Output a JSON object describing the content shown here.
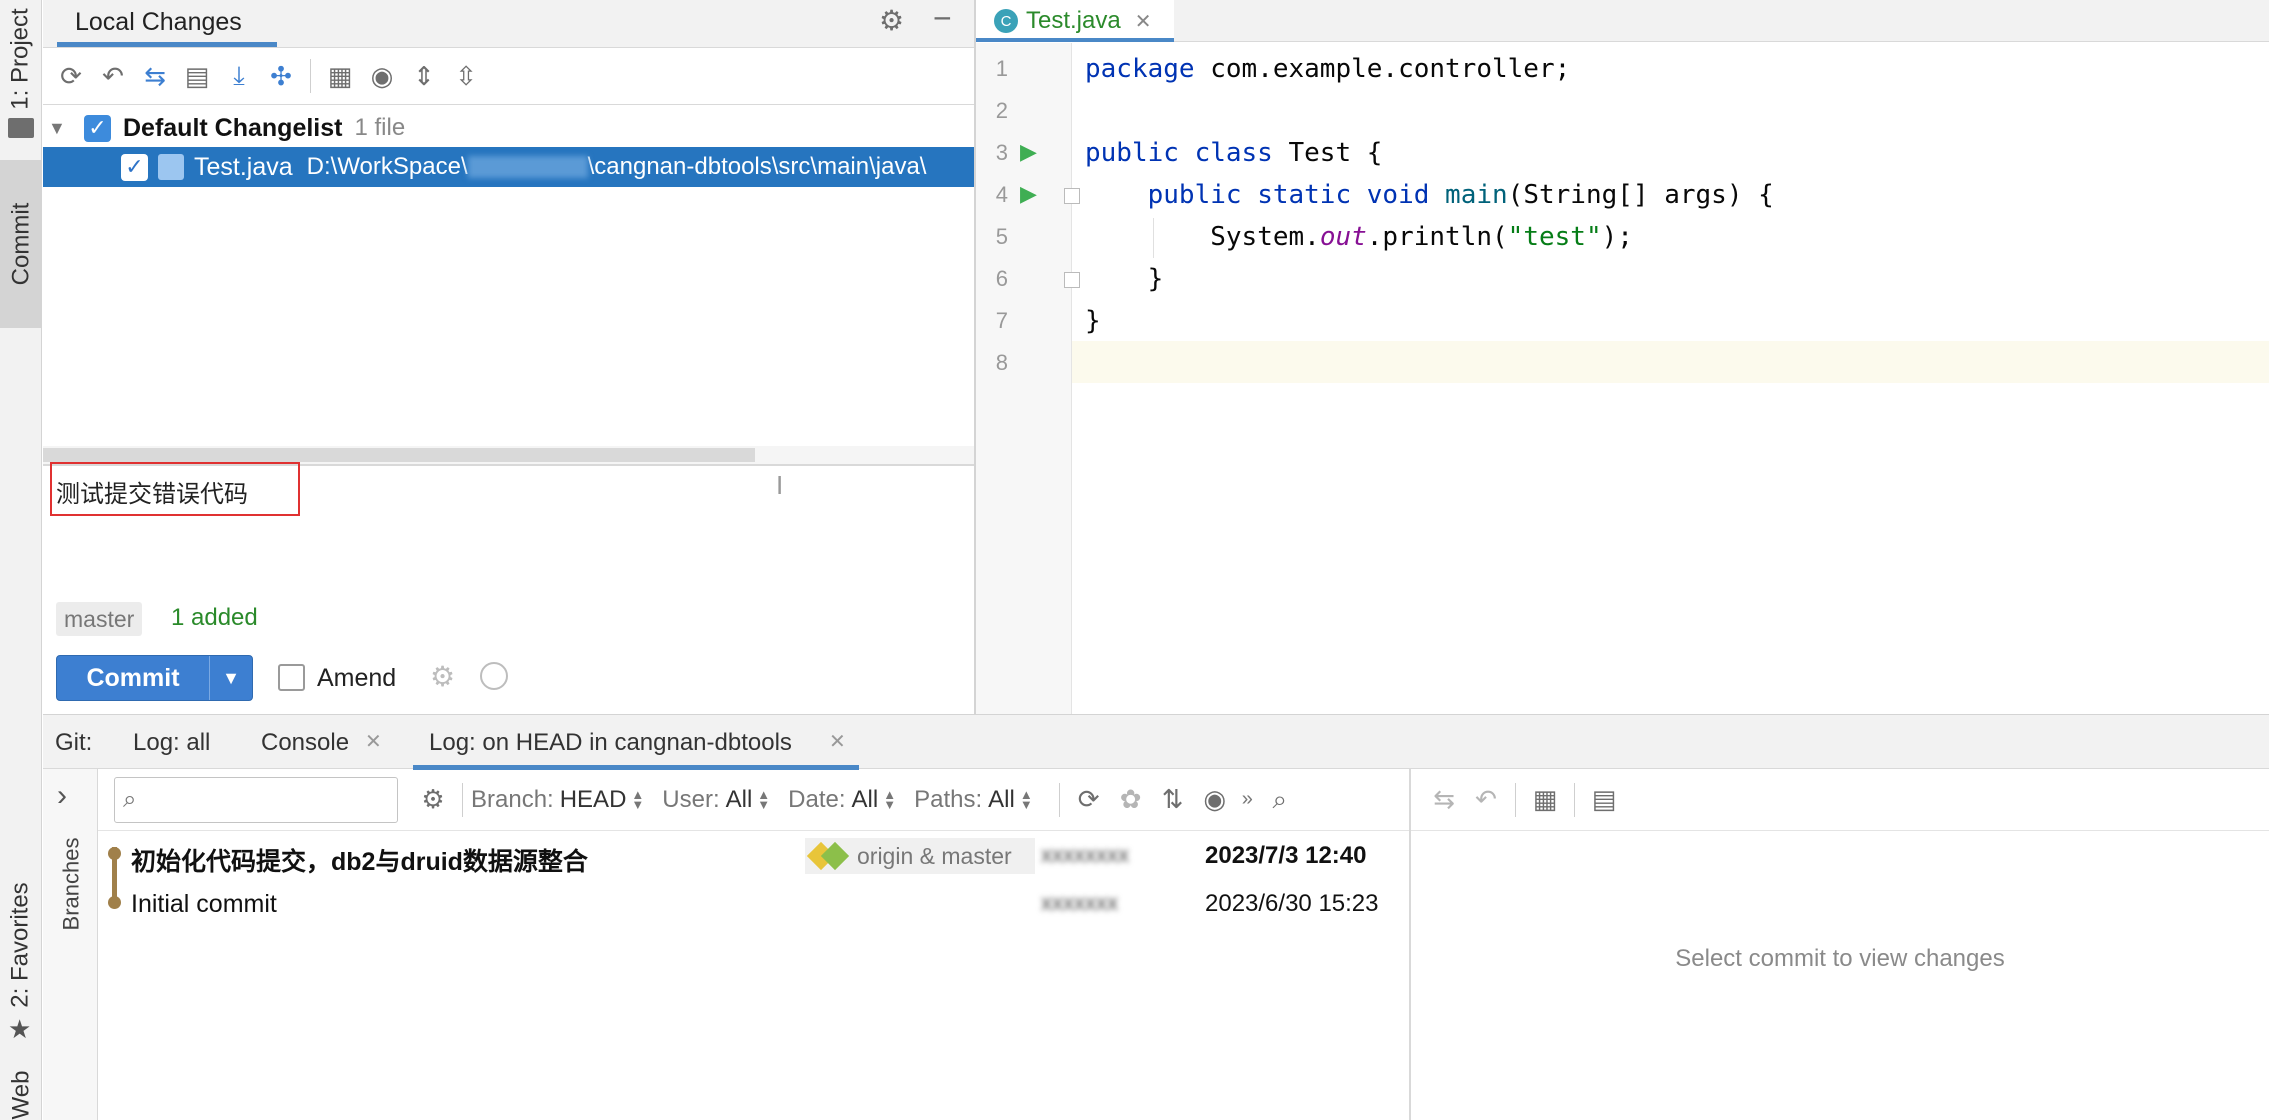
{
  "left_stripe": {
    "project": "1: Project",
    "commit": "Commit",
    "favorites": "2: Favorites",
    "web": "Web"
  },
  "local_changes": {
    "tab_label": "Local Changes",
    "toolbar_icons": [
      "refresh-icon",
      "rollback-icon",
      "show-diff-icon",
      "changelist-icon",
      "update-icon",
      "shelve-icon",
      "group-by-icon",
      "view-options-icon",
      "expand-all-icon",
      "collapse-all-icon"
    ],
    "changelist_name": "Default Changelist",
    "changelist_count": "1 file",
    "file_name": "Test.java",
    "file_path_start": "D:\\WorkSpace\\",
    "file_path_blurred": "xxxxxxxxx",
    "file_path_end": "\\cangnan-dbtools\\src\\main\\java\\"
  },
  "commit_panel": {
    "message": "测试提交错误代码",
    "branch": "master",
    "stats": "1 added",
    "commit_button": "Commit",
    "amend_label": "Amend",
    "accent": "#3d7fd1",
    "added_color": "#2a8a2a"
  },
  "editor": {
    "tab_label": "Test.java",
    "line_numbers": [
      "1",
      "2",
      "3",
      "4",
      "5",
      "6",
      "7",
      "8"
    ],
    "code": {
      "l1_kw": "package",
      "l1_rest": " com.example.controller;",
      "l3_kw": "public class",
      "l3_rest": " Test {",
      "l4_indent": "    ",
      "l4_kw": "public static void",
      "l4_fn": " main",
      "l4_rest": "(String[] args) {",
      "l5_indent": "        ",
      "l5_a": "System.",
      "l5_out": "out",
      "l5_b": ".println(",
      "l5_str": "\"test\"",
      "l5_c": ");",
      "l6": "    }",
      "l7": "}"
    }
  },
  "git_panel": {
    "label": "Git:",
    "tabs": [
      "Log: all",
      "Console",
      "Log: on HEAD in cangnan-dbtools"
    ],
    "branches_label": "Branches",
    "search_placeholder": "",
    "filters": {
      "branch_label": "Branch:",
      "branch_value": "HEAD",
      "user_label": "User:",
      "user_value": "All",
      "date_label": "Date:",
      "date_value": "All",
      "paths_label": "Paths:",
      "paths_value": "All"
    },
    "commits": [
      {
        "message": "初始化代码提交，db2与druid数据源整合",
        "refs": "origin & master",
        "author": "xxxxxxxx",
        "date": "2023/7/3 12:40"
      },
      {
        "message": "Initial commit",
        "refs": "",
        "author": "xxxxxxx",
        "date": "2023/6/30 15:23"
      }
    ],
    "details_placeholder": "Select commit to view changes"
  }
}
